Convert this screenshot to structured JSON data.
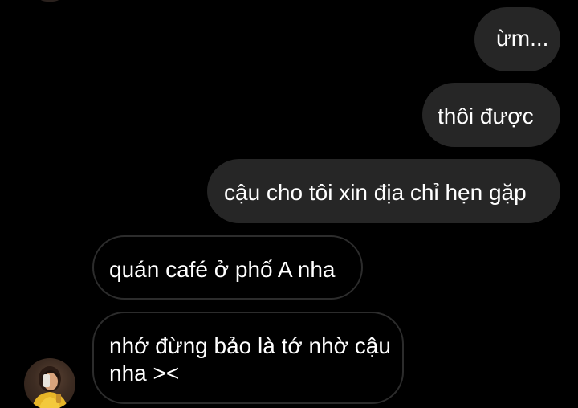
{
  "conversation": {
    "messages": [
      {
        "sender": "me",
        "text": "ừm..."
      },
      {
        "sender": "me",
        "text": "thôi được"
      },
      {
        "sender": "me",
        "text": "cậu cho tôi xin địa chỉ hẹn gặp"
      },
      {
        "sender": "other",
        "text": "quán café ở phố A nha"
      },
      {
        "sender": "other",
        "text": "nhớ đừng bảo là tớ nhờ cậu nha ><"
      }
    ]
  },
  "icons": {
    "contact_avatar": "contact-avatar-photo"
  },
  "colors": {
    "background": "#000000",
    "sent_bubble": "#262626",
    "received_bubble_border": "#2c2c2c",
    "text": "#ffffff"
  }
}
